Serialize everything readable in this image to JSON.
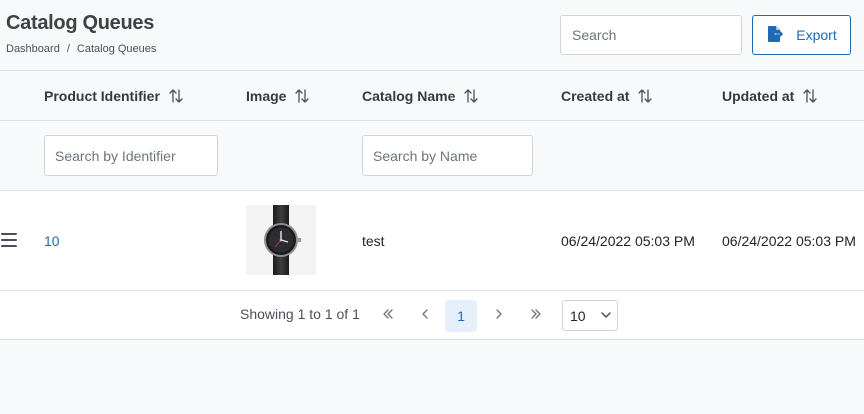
{
  "header": {
    "title": "Catalog Queues",
    "breadcrumb": [
      "Dashboard",
      "Catalog Queues"
    ],
    "breadcrumb_sep": "/",
    "search_placeholder": "Search",
    "export_label": "Export"
  },
  "table": {
    "columns": [
      "Product Identifier",
      "Image",
      "Catalog Name",
      "Created at",
      "Updated at"
    ],
    "filters": {
      "identifier_placeholder": "Search by Identifier",
      "name_placeholder": "Search by Name"
    },
    "rows": [
      {
        "identifier": "10",
        "image": "watch-thumbnail",
        "catalog_name": "test",
        "created_at": "06/24/2022 05:03 PM",
        "updated_at": "06/24/2022 05:03 PM"
      }
    ]
  },
  "pagination": {
    "info": "Showing 1 to 1 of 1",
    "current_page": "1",
    "rows_per_page": "10"
  },
  "colors": {
    "accent": "#1f6ab3",
    "header_bg": "#f8f9fb",
    "border": "#dee2e6",
    "active_page_bg": "#e6f0fb"
  },
  "icons": {
    "export": "file-export-icon",
    "sort": "sort-arrows-icon",
    "drag": "drag-handle-icon",
    "first": "double-chevron-left-icon",
    "prev": "chevron-left-icon",
    "next": "chevron-right-icon",
    "last": "double-chevron-right-icon",
    "dropdown": "chevron-down-icon"
  }
}
